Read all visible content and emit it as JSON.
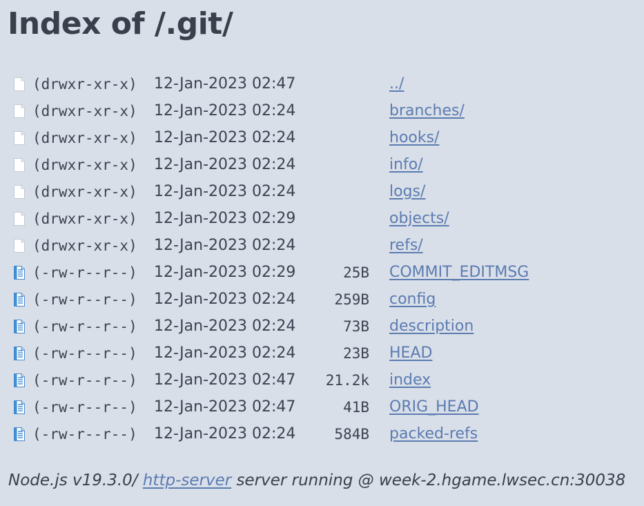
{
  "page": {
    "title": "Index of /.git/"
  },
  "entries": [
    {
      "icon": "blank-file-icon",
      "perms": "(drwxr-xr-x)",
      "date": "12-Jan-2023 02:47",
      "size": "",
      "name": "../"
    },
    {
      "icon": "blank-file-icon",
      "perms": "(drwxr-xr-x)",
      "date": "12-Jan-2023 02:24",
      "size": "",
      "name": "branches/"
    },
    {
      "icon": "blank-file-icon",
      "perms": "(drwxr-xr-x)",
      "date": "12-Jan-2023 02:24",
      "size": "",
      "name": "hooks/"
    },
    {
      "icon": "blank-file-icon",
      "perms": "(drwxr-xr-x)",
      "date": "12-Jan-2023 02:24",
      "size": "",
      "name": "info/"
    },
    {
      "icon": "blank-file-icon",
      "perms": "(drwxr-xr-x)",
      "date": "12-Jan-2023 02:24",
      "size": "",
      "name": "logs/"
    },
    {
      "icon": "blank-file-icon",
      "perms": "(drwxr-xr-x)",
      "date": "12-Jan-2023 02:29",
      "size": "",
      "name": "objects/"
    },
    {
      "icon": "blank-file-icon",
      "perms": "(drwxr-xr-x)",
      "date": "12-Jan-2023 02:24",
      "size": "",
      "name": "refs/"
    },
    {
      "icon": "text-file-icon",
      "perms": "(-rw-r--r--)",
      "date": "12-Jan-2023 02:29",
      "size": "25B",
      "name": "COMMIT_EDITMSG"
    },
    {
      "icon": "text-file-icon",
      "perms": "(-rw-r--r--)",
      "date": "12-Jan-2023 02:24",
      "size": "259B",
      "name": "config"
    },
    {
      "icon": "text-file-icon",
      "perms": "(-rw-r--r--)",
      "date": "12-Jan-2023 02:24",
      "size": "73B",
      "name": "description"
    },
    {
      "icon": "text-file-icon",
      "perms": "(-rw-r--r--)",
      "date": "12-Jan-2023 02:24",
      "size": "23B",
      "name": "HEAD"
    },
    {
      "icon": "text-file-icon",
      "perms": "(-rw-r--r--)",
      "date": "12-Jan-2023 02:47",
      "size": "21.2k",
      "name": "index"
    },
    {
      "icon": "text-file-icon",
      "perms": "(-rw-r--r--)",
      "date": "12-Jan-2023 02:47",
      "size": "41B",
      "name": "ORIG_HEAD"
    },
    {
      "icon": "text-file-icon",
      "perms": "(-rw-r--r--)",
      "date": "12-Jan-2023 02:24",
      "size": "584B",
      "name": "packed-refs"
    }
  ],
  "footer": {
    "prefix": "Node.js v19.3.0/ ",
    "link_text": "http-server",
    "suffix": " server running @ week-2.hgame.lwsec.cn:30038"
  },
  "colors": {
    "background": "#d9dfe9",
    "text": "#39404c",
    "link": "#5b7bb0"
  }
}
